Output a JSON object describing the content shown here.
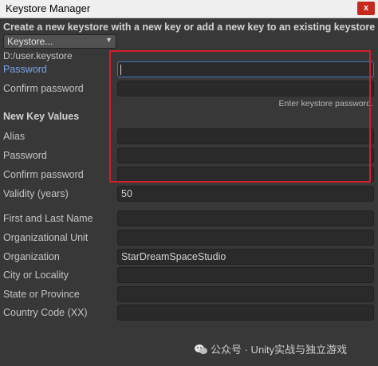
{
  "window": {
    "title": "Keystore Manager",
    "close_label": "x"
  },
  "header": {
    "text": "Create a new keystore with a new key or add a new key to an existing keystore"
  },
  "keystore_dropdown": {
    "selected": "Keystore..."
  },
  "keystore_path": "D:/user.keystore",
  "keystore_section": {
    "password_label": "Password",
    "password_value": "",
    "confirm_label": "Confirm password",
    "confirm_value": "",
    "hint": "Enter keystore password."
  },
  "new_key": {
    "heading": "New Key Values",
    "alias_label": "Alias",
    "alias_value": "",
    "password_label": "Password",
    "password_value": "",
    "confirm_label": "Confirm password",
    "confirm_value": "",
    "validity_label": "Validity (years)",
    "validity_value": "50"
  },
  "identity": {
    "name_label": "First and Last Name",
    "name_value": "",
    "unit_label": "Organizational Unit",
    "unit_value": "",
    "org_label": "Organization",
    "org_value": "StarDreamSpaceStudio",
    "city_label": "City or Locality",
    "city_value": "",
    "state_label": "State or Province",
    "state_value": "",
    "country_label": "Country Code (XX)",
    "country_value": ""
  },
  "watermark": {
    "text": "公众号 · Unity实战与独立游戏"
  },
  "colors": {
    "background": "#383838",
    "field": "#2a2a2a",
    "focus_label": "#7aa2e8",
    "highlight_box": "#d21f2a"
  }
}
